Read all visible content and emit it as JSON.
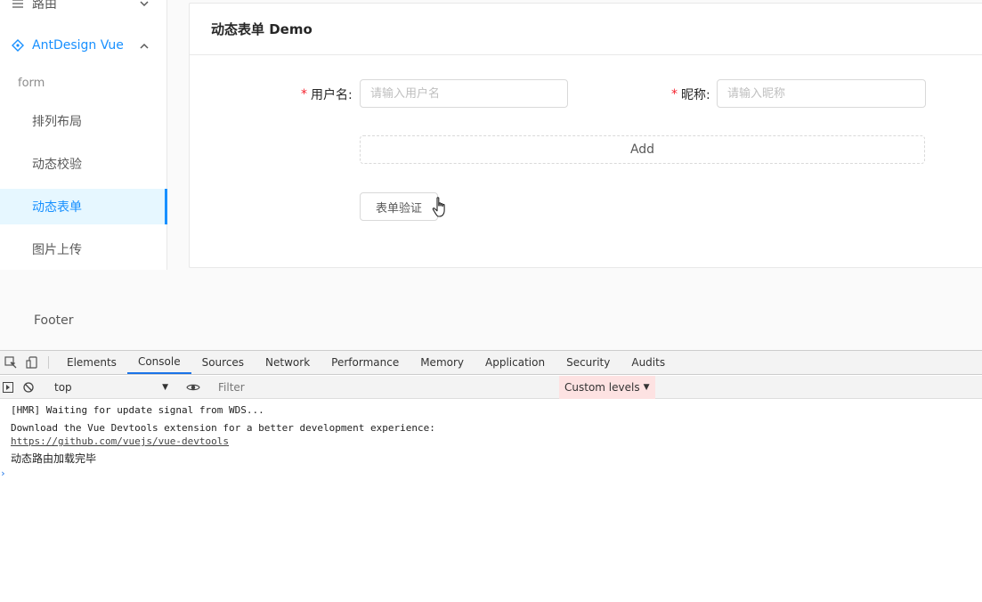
{
  "sidebar": {
    "cut_item_label": "路由",
    "submenu_label": "AntDesign Vue",
    "group_title": "form",
    "items": [
      {
        "label": "排列布局"
      },
      {
        "label": "动态校验"
      },
      {
        "label": "动态表单",
        "active": true
      },
      {
        "label": "图片上传"
      }
    ]
  },
  "card": {
    "title": "动态表单 Demo",
    "username_label": "用户名:",
    "username_placeholder": "请输入用户名",
    "nickname_label": "昵称:",
    "nickname_placeholder": "请输入昵称",
    "add_label": "Add",
    "validate_label": "表单验证"
  },
  "footer": "Footer",
  "devtools": {
    "tabs": [
      "Elements",
      "Console",
      "Sources",
      "Network",
      "Performance",
      "Memory",
      "Application",
      "Security",
      "Audits"
    ],
    "active_tab": "Console",
    "context": "top",
    "filter_placeholder": "Filter",
    "levels": "Custom levels",
    "logs": {
      "hmr": "[HMR] Waiting for update signal from WDS...",
      "devtools_hint": "Download the Vue Devtools extension for a better development experience:",
      "devtools_link": "https://github.com/vuejs/vue-devtools",
      "route_loaded": "动态路由加载完毕"
    }
  },
  "colors": {
    "primary": "#1890ff",
    "required": "#f5222d",
    "devtools_active": "#1a73e8"
  }
}
